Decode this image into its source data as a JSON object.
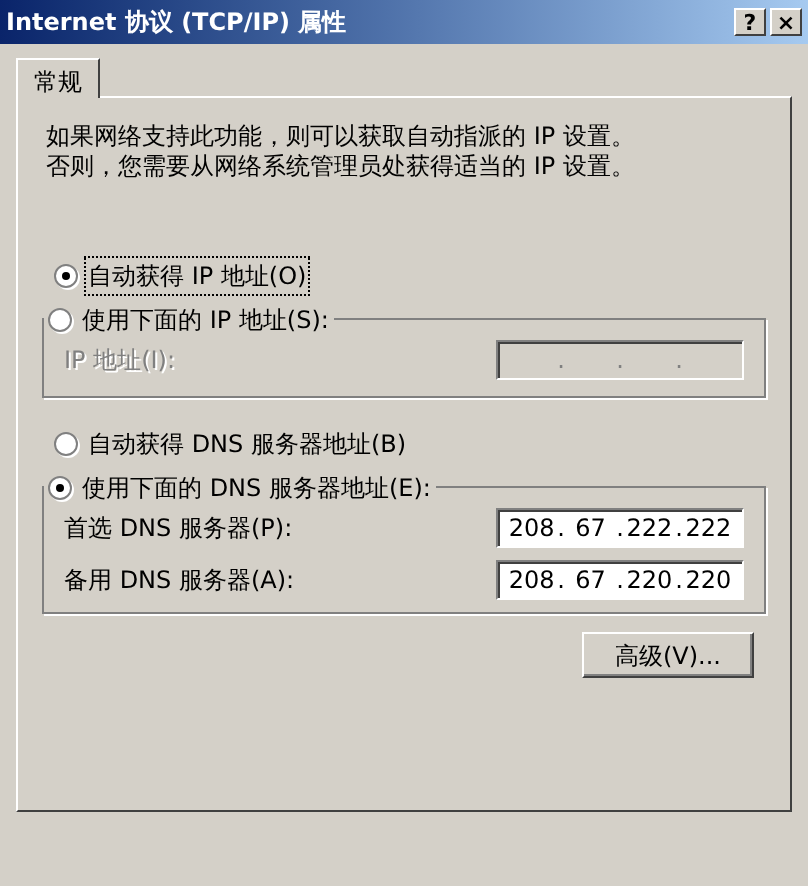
{
  "window": {
    "title": "Internet 协议 (TCP/IP) 属性",
    "buttons": [
      "?",
      "×"
    ]
  },
  "tabs": [
    {
      "label": "常规",
      "selected": true
    }
  ],
  "description": "如果网络支持此功能，则可以获取自动指派的 IP 设置。否则，您需要从网络系统管理员处获得适当的 IP 设置。",
  "ip_options": [
    {
      "label": "自动获得 IP 地址(O)",
      "selected": true,
      "focused": true
    },
    {
      "label": "使用下面的 IP 地址(S):",
      "selected": false,
      "focused": false
    }
  ],
  "ip_group": {
    "fields": [
      {
        "label": "IP 地址(I):",
        "disabled": true,
        "separator": "."
      }
    ]
  },
  "dns_options": [
    {
      "label": "自动获得 DNS 服务器地址(B)",
      "selected": false,
      "focused": false
    },
    {
      "label": "使用下面的 DNS 服务器地址(E):",
      "selected": true,
      "focused": false
    }
  ],
  "dns_group": {
    "fields": [
      {
        "label": "首选 DNS 服务器(P):",
        "disabled": false,
        "separator": ".",
        "octets": [
          "208",
          "67",
          "222",
          "222"
        ]
      },
      {
        "label": "备用 DNS 服务器(A):",
        "disabled": false,
        "separator": ".",
        "octets": [
          "208",
          "67",
          "220",
          "220"
        ]
      }
    ]
  },
  "advanced_button": "高级(V)..."
}
